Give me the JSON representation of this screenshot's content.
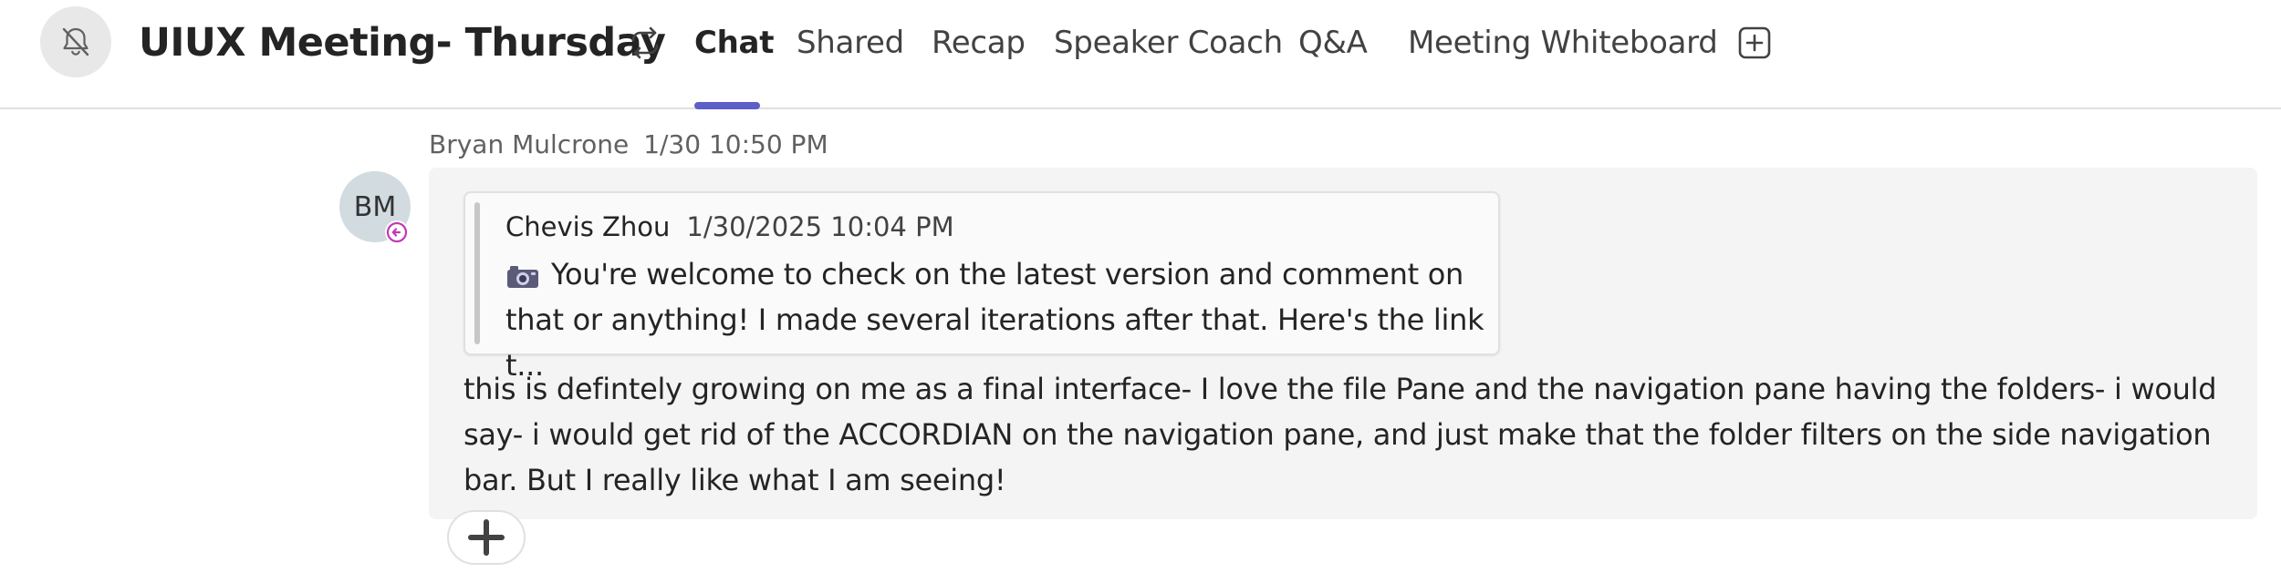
{
  "header": {
    "title": "UIUX Meeting- Thursday",
    "icons": {
      "notifications": "bell-off-icon",
      "sync": "sync-icon",
      "add_tab": "add-tab-icon"
    },
    "tabs": [
      {
        "label": "Chat",
        "active": true
      },
      {
        "label": "Shared",
        "active": false
      },
      {
        "label": "Recap",
        "active": false
      },
      {
        "label": "Speaker Coach",
        "active": false
      },
      {
        "label": "Q&A",
        "active": false
      },
      {
        "label": "Meeting Whiteboard",
        "active": false
      }
    ],
    "accent_color": "#5b5fc7"
  },
  "message": {
    "sender": "Bryan Mulcrone",
    "timestamp": "1/30 10:50 PM",
    "avatar_initials": "BM",
    "presence": "away-presence-icon",
    "quote": {
      "author": "Chevis Zhou",
      "timestamp": "1/30/2025 10:04 PM",
      "icon": "camera-icon",
      "text": "You're welcome to check on the latest version and comment on that or anything! I made several iterations after that. Here's the link t..."
    },
    "body": "this is defintely growing on me as a final interface- I love the file Pane and the navigation pane having the folders- i would say- i would get rid of the ACCORDIAN on the navigation pane, and just make that the folder filters on the side navigation bar. But I really like what I am seeing!"
  },
  "actions": {
    "reaction_icon": "plus-icon"
  }
}
